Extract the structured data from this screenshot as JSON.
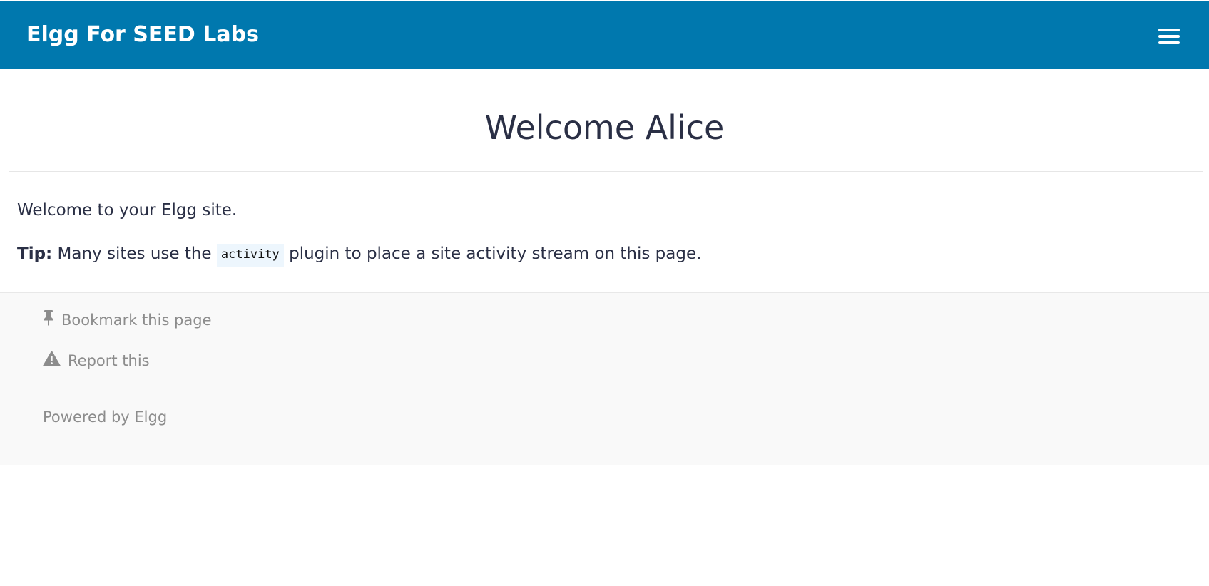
{
  "header": {
    "site_title": "Elgg For SEED Labs",
    "menu_icon": "hamburger-menu-icon",
    "background_color": "#0078ae"
  },
  "main": {
    "title": "Welcome Alice",
    "intro": "Welcome to your Elgg site.",
    "tip": {
      "label": "Tip:",
      "before": "Many sites use the",
      "code": "activity",
      "after": "plugin to place a site activity stream on this page."
    }
  },
  "footer": {
    "bookmark": {
      "icon": "pushpin-icon",
      "label": "Bookmark this page"
    },
    "report": {
      "icon": "warning-triangle-icon",
      "label": "Report this"
    },
    "powered_by": "Powered by Elgg"
  }
}
